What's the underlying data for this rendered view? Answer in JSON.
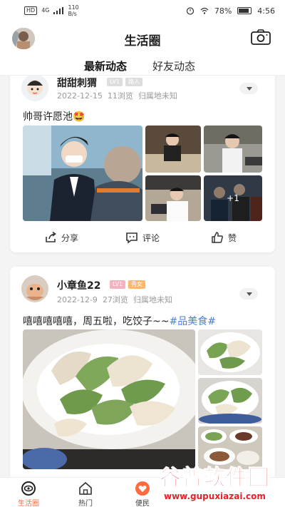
{
  "status_bar": {
    "hd": "HD",
    "network": "4G",
    "speed_value": "110",
    "speed_unit": "B/s",
    "battery": "78%",
    "time": "4:56"
  },
  "header": {
    "title": "生活圈",
    "camera_icon": "camera-icon"
  },
  "tabs": [
    {
      "label": "最新动态",
      "active": true
    },
    {
      "label": "好友动态",
      "active": false
    }
  ],
  "posts": [
    {
      "author": "甜甜刺猬",
      "level": "LV1",
      "tag": "路人",
      "date": "2022-12-15",
      "views": "11浏览",
      "location": "归属地未知",
      "text": "帅哥许愿池🤩",
      "more_images": "+1"
    },
    {
      "author": "小章鱼22",
      "level": "LV1",
      "tag": "秀女",
      "date": "2022-12-9",
      "views": "27浏览",
      "location": "归属地未知",
      "text": "嘻嘻嘻嘻嘻，周五啦，吃饺子~~",
      "hashtag": "#品美食#"
    }
  ],
  "actions": {
    "share": "分享",
    "comment": "评论",
    "like": "赞"
  },
  "bottom_nav": [
    {
      "label": "生活圈",
      "icon": "eye-circle-icon",
      "active": true
    },
    {
      "label": "热门",
      "icon": "house-icon",
      "active": false
    },
    {
      "label": "便民",
      "icon": "heart-icon",
      "active": false
    }
  ],
  "watermark": {
    "title": "谷普软件园",
    "url": "www.gupuxiazai.com"
  },
  "colors": {
    "accent": "#ff6b3d",
    "hashtag": "#4a7fd6",
    "watermark": "#e8202a"
  }
}
